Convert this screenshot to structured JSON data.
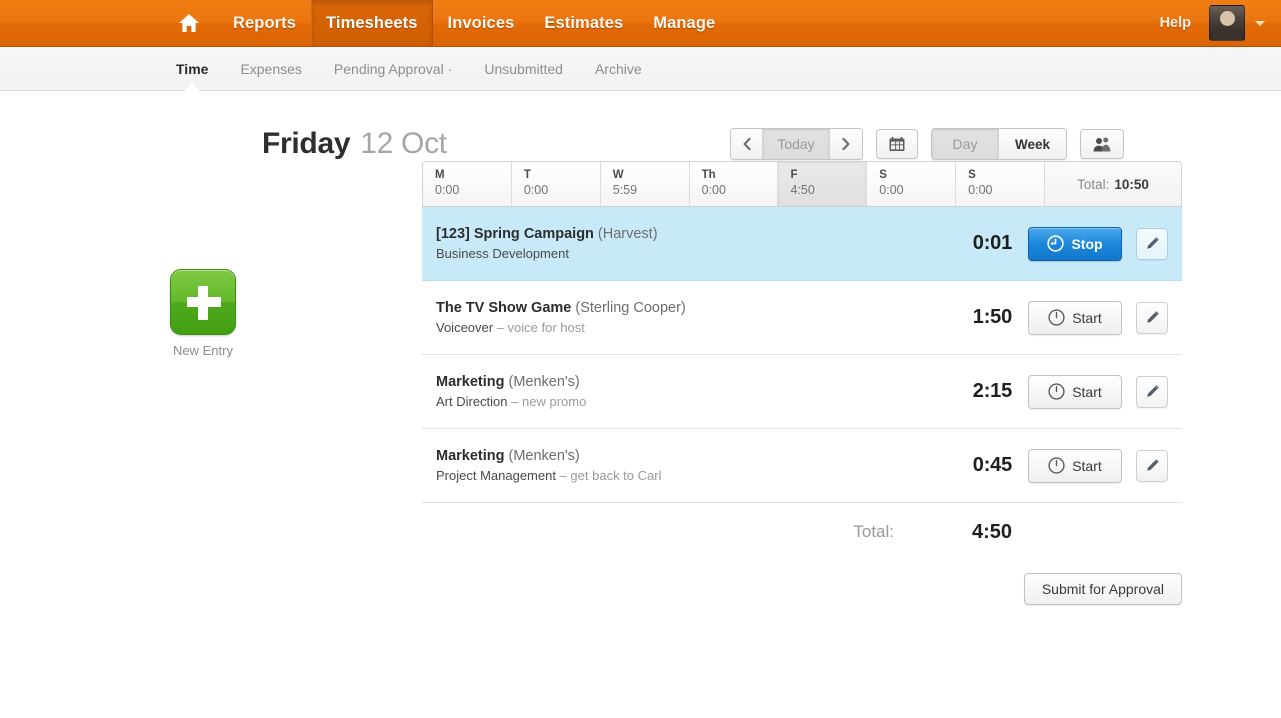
{
  "topnav": {
    "home_icon": "home-icon",
    "items": [
      {
        "label": "Reports",
        "active": false
      },
      {
        "label": "Timesheets",
        "active": true
      },
      {
        "label": "Invoices",
        "active": false
      },
      {
        "label": "Estimates",
        "active": false
      },
      {
        "label": "Manage",
        "active": false
      }
    ],
    "help_label": "Help",
    "avatar_icon": "user-avatar-photo",
    "caret_icon": "chevron-down-icon",
    "brand_color": "#e8720c"
  },
  "subnav": {
    "items": [
      {
        "label": "Time",
        "active": true
      },
      {
        "label": "Expenses",
        "active": false
      },
      {
        "label": "Pending Approval",
        "active": false,
        "suffix": "·"
      },
      {
        "label": "Unsubmitted",
        "active": false
      },
      {
        "label": "Archive",
        "active": false
      }
    ]
  },
  "page": {
    "title_day": "Friday",
    "title_date": "12 Oct"
  },
  "toolbar": {
    "prev_label": "‹",
    "today_label": "Today",
    "next_label": "›",
    "calendar_icon": "calendar-icon",
    "day_label": "Day",
    "week_label": "Week",
    "people_icon": "people-icon"
  },
  "new_entry": {
    "icon": "plus-icon",
    "label": "New Entry"
  },
  "week": {
    "days": [
      {
        "name": "M",
        "hours": "0:00",
        "selected": false
      },
      {
        "name": "T",
        "hours": "0:00",
        "selected": false
      },
      {
        "name": "W",
        "hours": "5:59",
        "selected": false
      },
      {
        "name": "Th",
        "hours": "0:00",
        "selected": false
      },
      {
        "name": "F",
        "hours": "4:50",
        "selected": true
      },
      {
        "name": "S",
        "hours": "0:00",
        "selected": false
      },
      {
        "name": "S",
        "hours": "0:00",
        "selected": false
      }
    ],
    "total_label": "Total:",
    "total_value": "10:50"
  },
  "entries": [
    {
      "project": "[123] Spring Campaign",
      "client": "(Harvest)",
      "task": "Business Development",
      "notes": "",
      "hours": "0:01",
      "running": true,
      "button_label": "Stop",
      "button_icon": "timer-stop-icon",
      "edit_icon": "pencil-icon"
    },
    {
      "project": "The TV Show Game",
      "client": "(Sterling Cooper)",
      "task": "Voiceover",
      "notes": "– voice for host",
      "hours": "1:50",
      "running": false,
      "button_label": "Start",
      "button_icon": "timer-start-icon",
      "edit_icon": "pencil-icon"
    },
    {
      "project": "Marketing",
      "client": "(Menken's)",
      "task": "Art Direction",
      "notes": "– new promo",
      "hours": "2:15",
      "running": false,
      "button_label": "Start",
      "button_icon": "timer-start-icon",
      "edit_icon": "pencil-icon"
    },
    {
      "project": "Marketing",
      "client": "(Menken's)",
      "task": "Project Management",
      "notes": "– get back to Carl",
      "hours": "0:45",
      "running": false,
      "button_label": "Start",
      "button_icon": "timer-start-icon",
      "edit_icon": "pencil-icon"
    }
  ],
  "footer": {
    "total_label": "Total:",
    "total_value": "4:50",
    "submit_label": "Submit for Approval"
  }
}
